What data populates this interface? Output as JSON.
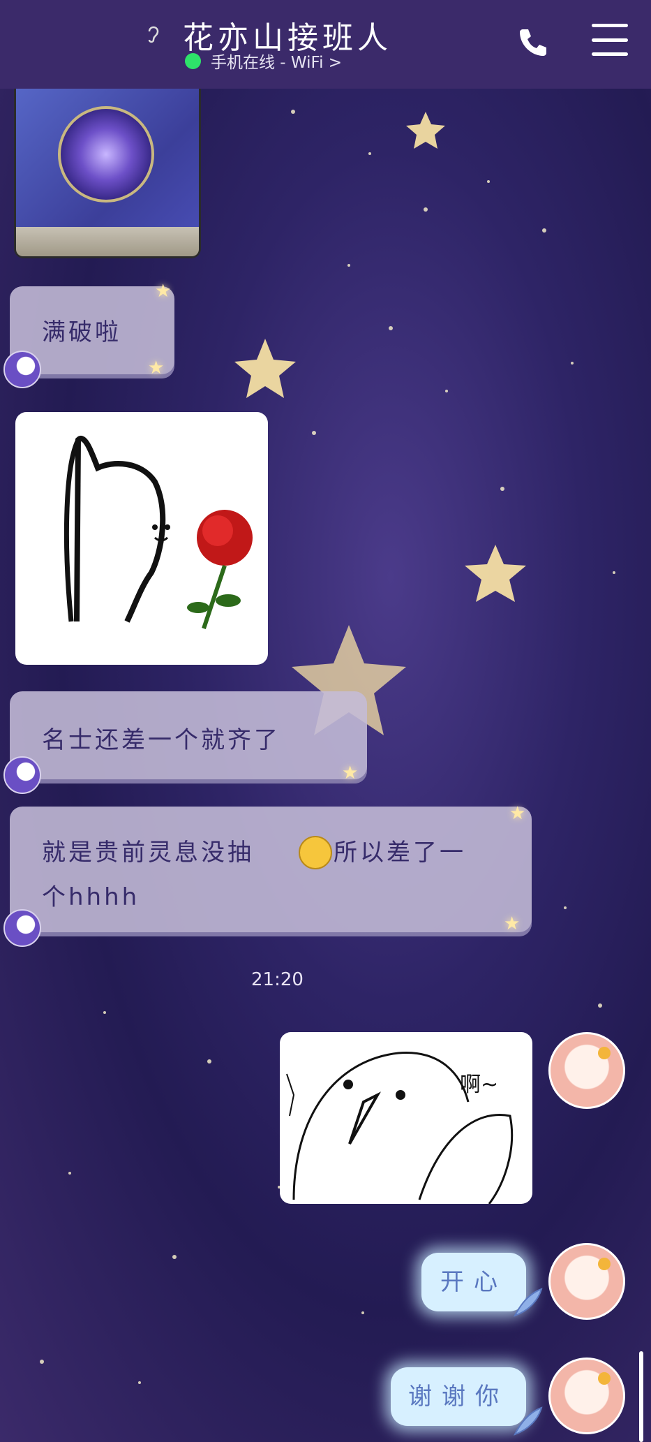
{
  "header": {
    "title": "花亦山接班人",
    "status": "手机在线 - WiFi >"
  },
  "messages": [
    {
      "text": "满破啦"
    },
    {
      "text": "名士还差一个就齐了"
    },
    {
      "line1": "就是贵前灵息没抽",
      "line2": "所以差了一",
      "line3": "个hhhh"
    }
  ],
  "time": "21:20",
  "stickers": {
    "received_caption": "",
    "sent_caption": "啊~"
  },
  "sent": [
    {
      "text": "开心"
    },
    {
      "text": "谢谢你"
    }
  ],
  "colors": {
    "header_bg": "#3b2a6a",
    "online_dot": "#2ee36a",
    "received_bubble": "#c4bcd7",
    "sent_bubble": "#d7f0ff"
  }
}
